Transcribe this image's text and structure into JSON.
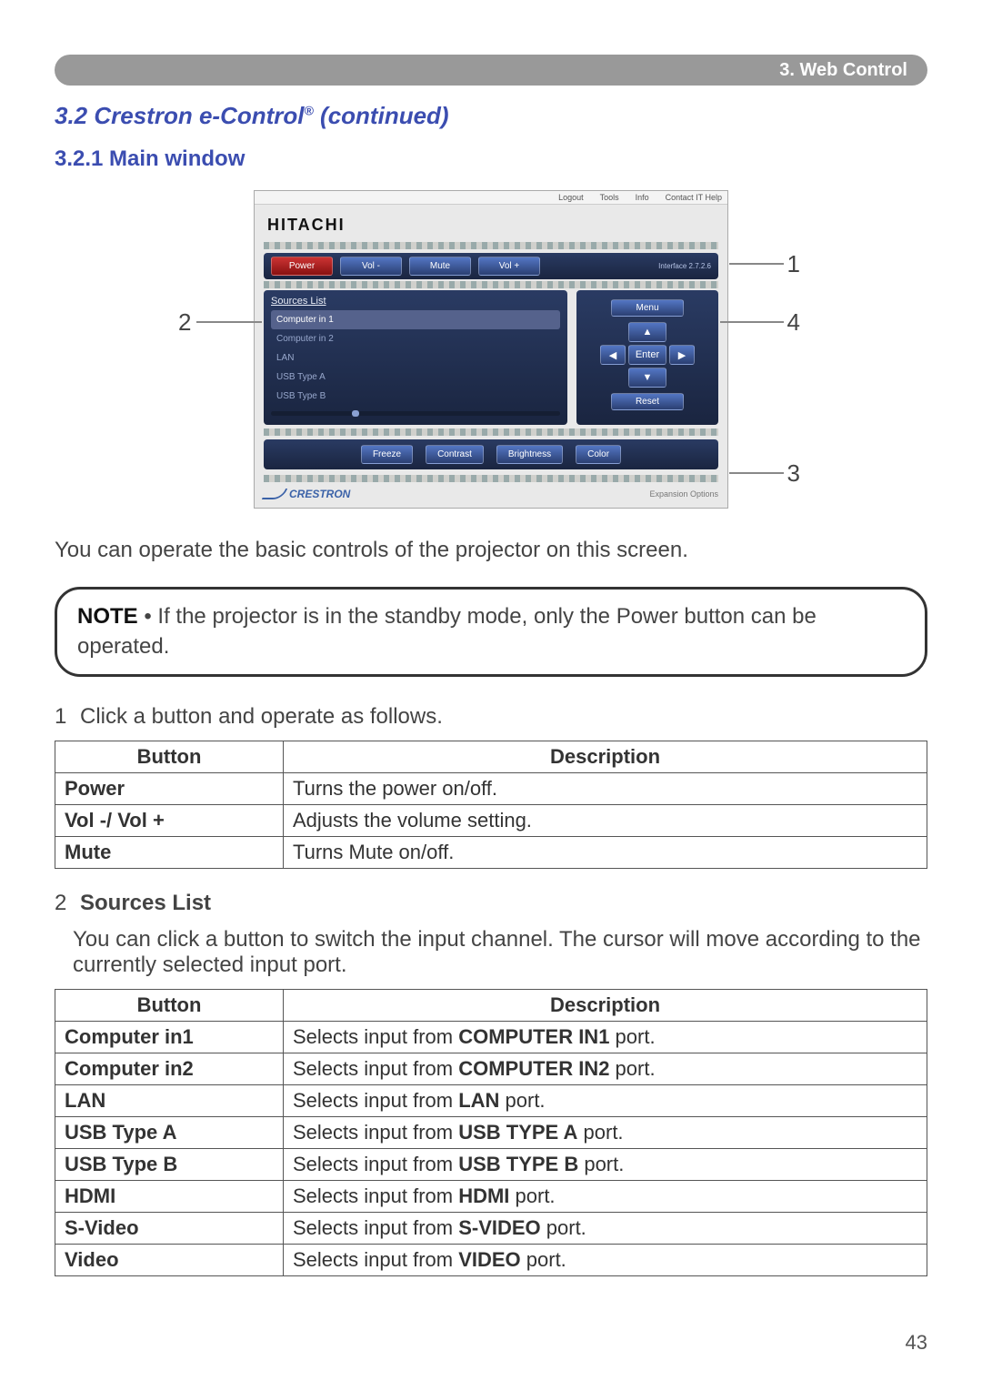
{
  "header": {
    "breadcrumb": "3. Web Control"
  },
  "section": {
    "title_pre": "3.2 Crestron e-Control",
    "title_suffix": " (continued)",
    "subsection": "3.2.1 Main window"
  },
  "figure": {
    "tabs": {
      "logout": "Logout",
      "tools": "Tools",
      "info": "Info",
      "contact": "Contact IT Help"
    },
    "logo": "HITACHI",
    "topbar": {
      "power": "Power",
      "volm": "Vol -",
      "mute": "Mute",
      "volp": "Vol +",
      "intf": "Interface 2.7.2.6"
    },
    "sources": {
      "title": "Sources List",
      "items": [
        "Computer in 1",
        "Computer in 2",
        "LAN",
        "USB Type A",
        "USB Type B"
      ]
    },
    "dpad": {
      "menu": "Menu",
      "enter": "Enter",
      "reset": "Reset",
      "up": "▲",
      "down": "▼",
      "left": "◀",
      "right": "▶"
    },
    "bottom": {
      "freeze": "Freeze",
      "contrast": "Contrast",
      "brightness": "Brightness",
      "color": "Color"
    },
    "footer": {
      "brand": "CRESTRON",
      "opts": "Expansion Options"
    },
    "callouts": {
      "c1": "1",
      "c2": "2",
      "c3": "3",
      "c4": "4"
    }
  },
  "body": {
    "intro": "You can operate the basic controls of the projector on this screen.",
    "note_label": "NOTE",
    "note_text": " • If the projector is in the standby mode, only the Power button can be operated.",
    "step1_num": "1",
    "step1_text": "Click a button and operate as follows.",
    "step2_num": "2",
    "step2_title": "Sources List",
    "step2_text": "You can click a button to switch the input channel. The cursor will move according to the currently selected input port."
  },
  "table1": {
    "head": {
      "c1": "Button",
      "c2": "Description"
    },
    "rows": [
      {
        "b": "Power",
        "d": "Turns the power on/off."
      },
      {
        "b": "Vol -/ Vol +",
        "d": "Adjusts the volume setting."
      },
      {
        "b": "Mute",
        "d": "Turns Mute on/off."
      }
    ]
  },
  "table2": {
    "head": {
      "c1": "Button",
      "c2": "Description"
    },
    "rows": [
      {
        "b": "Computer in1",
        "d_pre": "Selects input from ",
        "d_bold": "COMPUTER IN1",
        "d_post": " port."
      },
      {
        "b": "Computer in2",
        "d_pre": "Selects input from ",
        "d_bold": "COMPUTER IN2",
        "d_post": " port."
      },
      {
        "b": "LAN",
        "d_pre": "Selects input from ",
        "d_bold": "LAN",
        "d_post": " port."
      },
      {
        "b": "USB Type A",
        "d_pre": "Selects input from ",
        "d_bold": "USB TYPE A",
        "d_post": " port."
      },
      {
        "b": "USB Type B",
        "d_pre": "Selects input from ",
        "d_bold": "USB TYPE B",
        "d_post": " port."
      },
      {
        "b": "HDMI",
        "d_pre": "Selects input from ",
        "d_bold": "HDMI",
        "d_post": " port."
      },
      {
        "b": "S-Video",
        "d_pre": "Selects input from ",
        "d_bold": "S-VIDEO",
        "d_post": " port."
      },
      {
        "b": "Video",
        "d_pre": "Selects input from ",
        "d_bold": "VIDEO",
        "d_post": " port."
      }
    ]
  },
  "page_number": "43"
}
